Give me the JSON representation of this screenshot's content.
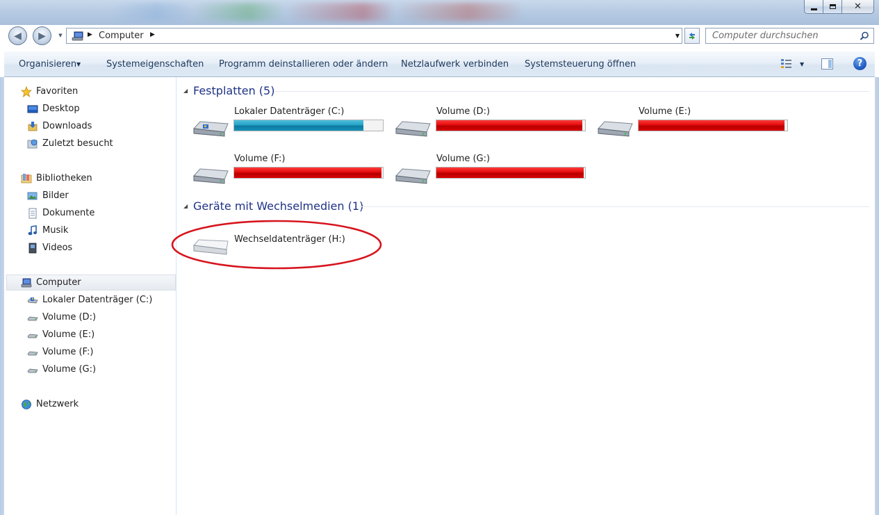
{
  "window": {
    "colors": {
      "accent": "#1e3287",
      "command_text": "#1e395b",
      "bar_normal": "#26a0c4",
      "bar_full": "#d50000",
      "annotation": "#d7141e"
    },
    "caption_icons": [
      "minimize-icon",
      "maximize-icon",
      "close-icon"
    ]
  },
  "address_bar": {
    "path": "Computer",
    "icon": "computer-icon"
  },
  "search": {
    "placeholder": "Computer durchsuchen",
    "icon": "search-icon"
  },
  "command_bar": {
    "organize": "Organisieren",
    "items": [
      "Systemeigenschaften",
      "Programm deinstallieren oder ändern",
      "Netzlaufwerk verbinden",
      "Systemsteuerung öffnen"
    ],
    "right_icons": [
      "view-options-icon",
      "preview-pane-icon",
      "help-icon"
    ]
  },
  "nav_pane": {
    "favorites": {
      "label": "Favoriten",
      "items": [
        {
          "label": "Desktop",
          "icon": "desktop-icon"
        },
        {
          "label": "Downloads",
          "icon": "downloads-icon"
        },
        {
          "label": "Zuletzt besucht",
          "icon": "recent-places-icon"
        }
      ]
    },
    "libraries": {
      "label": "Bibliotheken",
      "items": [
        {
          "label": "Bilder",
          "icon": "pictures-icon"
        },
        {
          "label": "Dokumente",
          "icon": "documents-icon"
        },
        {
          "label": "Musik",
          "icon": "music-icon"
        },
        {
          "label": "Videos",
          "icon": "videos-icon"
        }
      ]
    },
    "computer": {
      "label": "Computer",
      "items": [
        {
          "label": "Lokaler Datenträger (C:)",
          "icon": "system-drive-icon"
        },
        {
          "label": "Volume (D:)",
          "icon": "drive-icon"
        },
        {
          "label": "Volume (E:)",
          "icon": "drive-icon"
        },
        {
          "label": "Volume (F:)",
          "icon": "drive-icon"
        },
        {
          "label": "Volume (G:)",
          "icon": "drive-icon"
        }
      ]
    },
    "network": {
      "label": "Netzwerk",
      "icon": "network-icon"
    }
  },
  "content": {
    "hard_disks": {
      "title": "Festplatten (5)",
      "drives": [
        {
          "name": "Lokaler Datenträger (C:)",
          "used_fraction": 0.87,
          "state": "normal"
        },
        {
          "name": "Volume (D:)",
          "used_fraction": 0.98,
          "state": "full"
        },
        {
          "name": "Volume (E:)",
          "used_fraction": 0.98,
          "state": "full"
        },
        {
          "name": "Volume (F:)",
          "used_fraction": 0.99,
          "state": "full"
        },
        {
          "name": "Volume (G:)",
          "used_fraction": 0.99,
          "state": "full"
        }
      ]
    },
    "removable": {
      "title": "Geräte mit Wechselmedien (1)",
      "drives": [
        {
          "name": "Wechseldatenträger (H:)"
        }
      ]
    }
  }
}
